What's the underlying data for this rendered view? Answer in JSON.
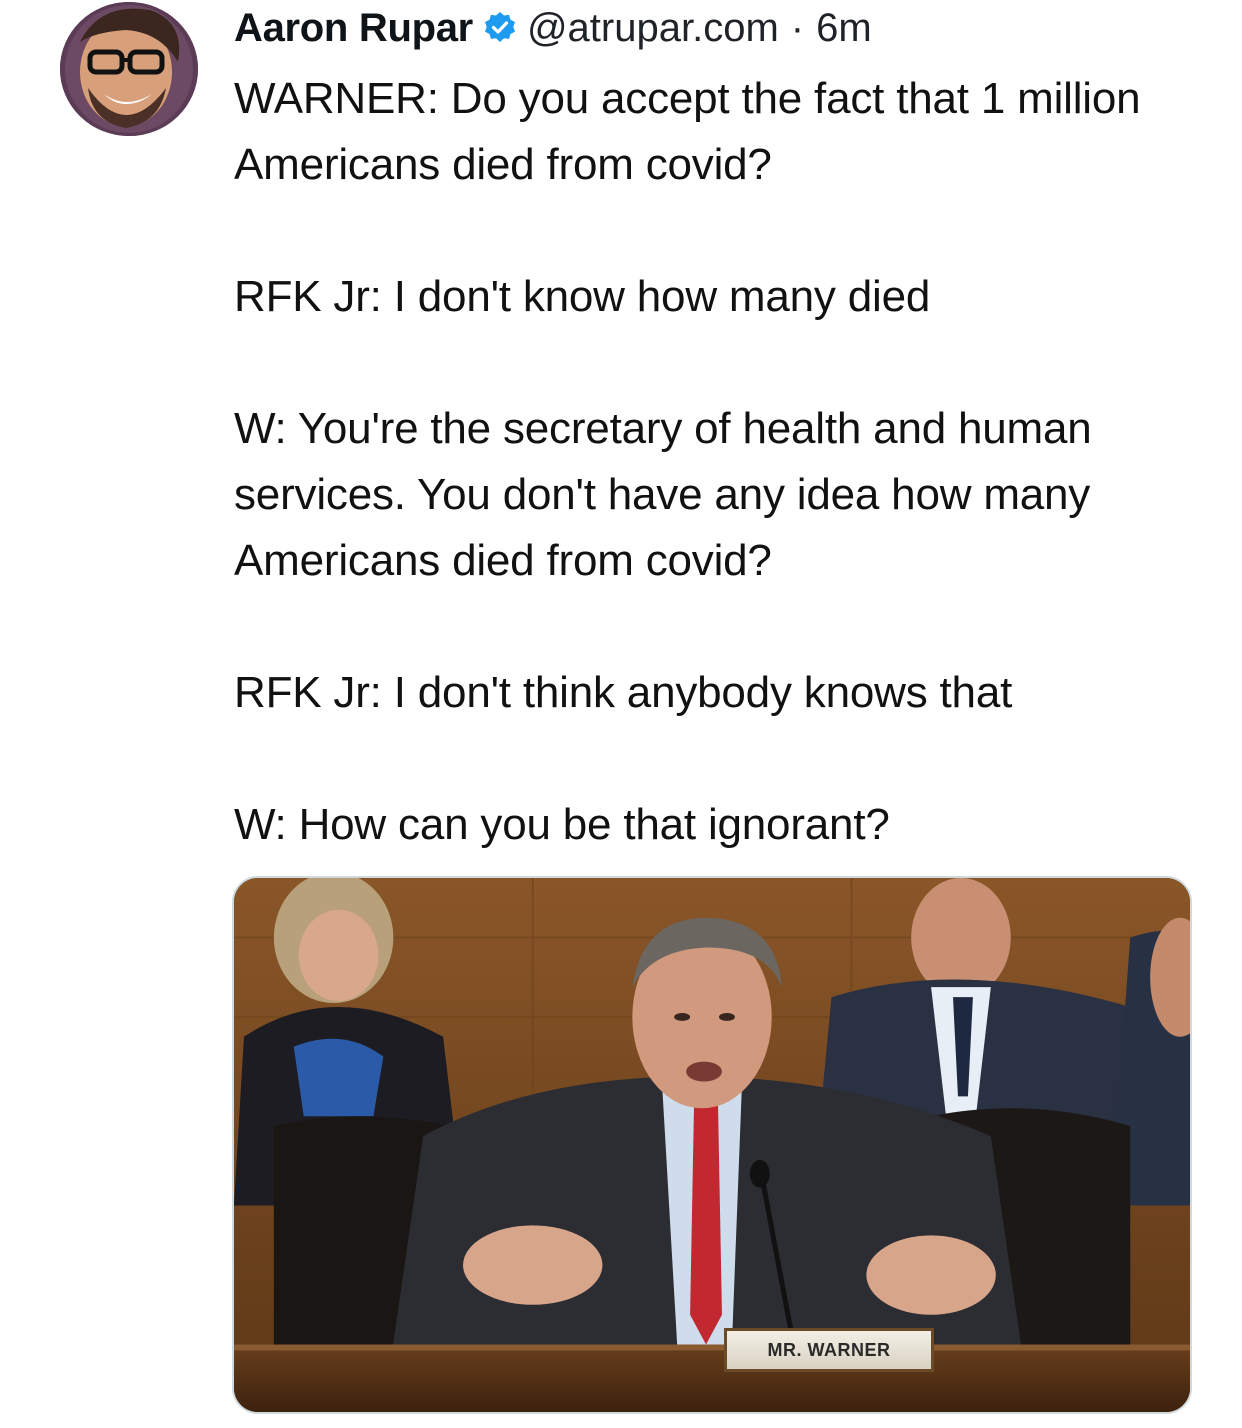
{
  "post": {
    "author_name": "Aaron Rupar",
    "handle": "@atrupar.com",
    "separator": "·",
    "time": "6m",
    "paragraphs": [
      "WARNER: Do you accept the fact that 1 million Americans died from covid?",
      "RFK Jr: I don't know how many died",
      "W: You're the secretary of health and human services. You don't have any idea how many Americans died from covid?",
      "RFK Jr: I don't think anybody knows that",
      "W: How can you be that ignorant?"
    ],
    "media": {
      "nameplate": "MR. WARNER"
    }
  },
  "icons": {
    "verified": "verified-badge-icon"
  },
  "colors": {
    "verified_blue": "#1d9bf0",
    "text": "#0f1419",
    "media_border": "#cfd9de"
  }
}
